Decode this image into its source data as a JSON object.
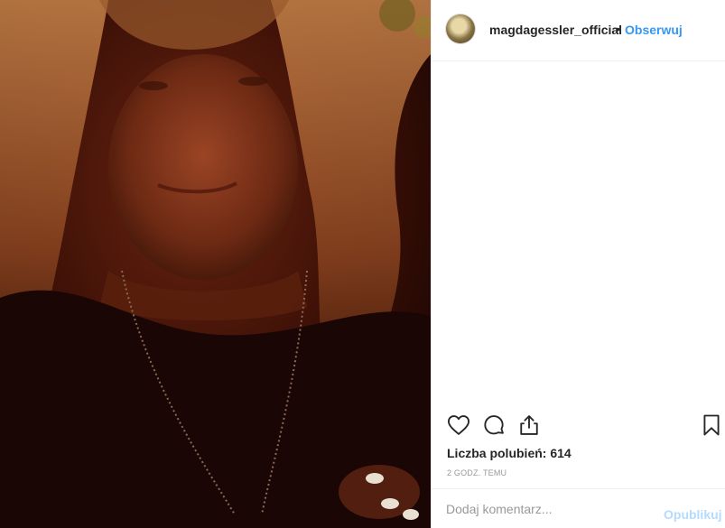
{
  "post": {
    "photo_alt": "",
    "colors": {
      "photo_dark": "#1f0703",
      "photo_warm": "#8a3a1a",
      "hair": "#b46a34"
    }
  },
  "header": {
    "username": "magdagessler_official",
    "separator": "•",
    "follow_label": "Obserwuj",
    "follow_color": "#3897f0"
  },
  "actions": {
    "like_icon": "heart-icon",
    "comment_icon": "comment-icon",
    "share_icon": "share-icon",
    "save_icon": "bookmark-icon"
  },
  "stats": {
    "likes_text": "Liczba polubień: 614",
    "time_text": "2 GODZ. TEMU"
  },
  "comment": {
    "placeholder": "Dodaj komentarz...",
    "publish_label": "Opublikuj",
    "publish_color": "#b3dbff"
  }
}
